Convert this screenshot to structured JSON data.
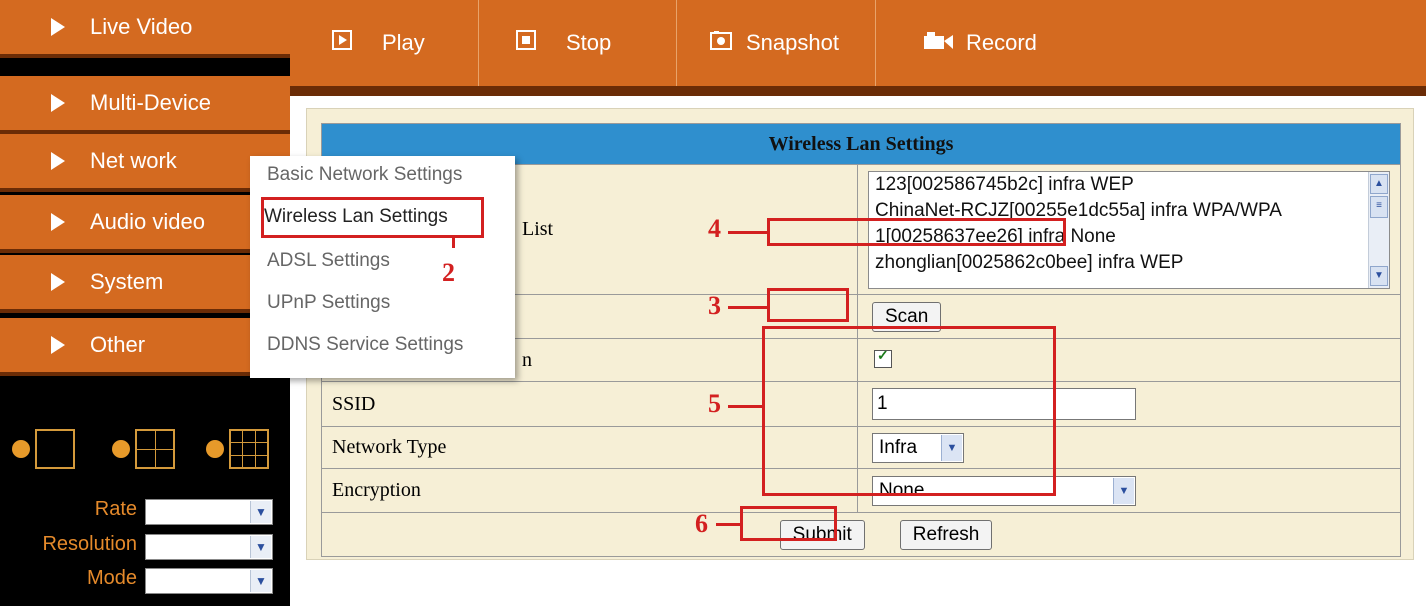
{
  "sidebar": {
    "items": [
      {
        "label": "Live Video"
      },
      {
        "label": "Multi-Device"
      },
      {
        "label": "Net work"
      },
      {
        "label": "Audio video"
      },
      {
        "label": "System"
      },
      {
        "label": "Other"
      }
    ],
    "layout_icons": [
      "single-view-icon",
      "quad-view-icon",
      "nine-view-icon"
    ],
    "controls": [
      {
        "label": "Rate",
        "value": ""
      },
      {
        "label": "Resolution",
        "value": ""
      },
      {
        "label": "Mode",
        "value": ""
      }
    ]
  },
  "toolbar": {
    "buttons": [
      {
        "label": "Play",
        "icon": "play-icon"
      },
      {
        "label": "Stop",
        "icon": "stop-icon"
      },
      {
        "label": "Snapshot",
        "icon": "camera-icon"
      },
      {
        "label": "Record",
        "icon": "video-camera-icon"
      }
    ]
  },
  "network_menu": {
    "items": [
      {
        "label": "Basic Network Settings"
      },
      {
        "label": "Wireless Lan Settings"
      },
      {
        "label": "ADSL Settings"
      },
      {
        "label": "UPnP Settings"
      },
      {
        "label": "DDNS Service Settings"
      }
    ]
  },
  "wireless": {
    "title": "Wireless Lan Settings",
    "list_label_partial": "List",
    "networks": [
      "123[002586745b2c] infra WEP",
      "ChinaNet-RCJZ[00255e1dc55a] infra WPA/WPA",
      "1[00258637ee26] infra None",
      "zhonglian[0025862c0bee] infra WEP"
    ],
    "scan_label": "Scan",
    "using_label_partial": "n",
    "using_checked": true,
    "ssid_label": "SSID",
    "ssid_value": "1",
    "network_type_label": "Network Type",
    "network_type_value": "Infra",
    "encryption_label": "Encryption",
    "encryption_value": "None",
    "submit_label": "Submit",
    "refresh_label": "Refresh"
  },
  "annotations": {
    "n2": "2",
    "n3": "3",
    "n4": "4",
    "n5": "5",
    "n6": "6"
  },
  "colors": {
    "nav_orange": "#d46a20",
    "title_blue": "#2f8fce",
    "annotation_red": "#d32020",
    "panel_bg": "#f6efd6"
  }
}
